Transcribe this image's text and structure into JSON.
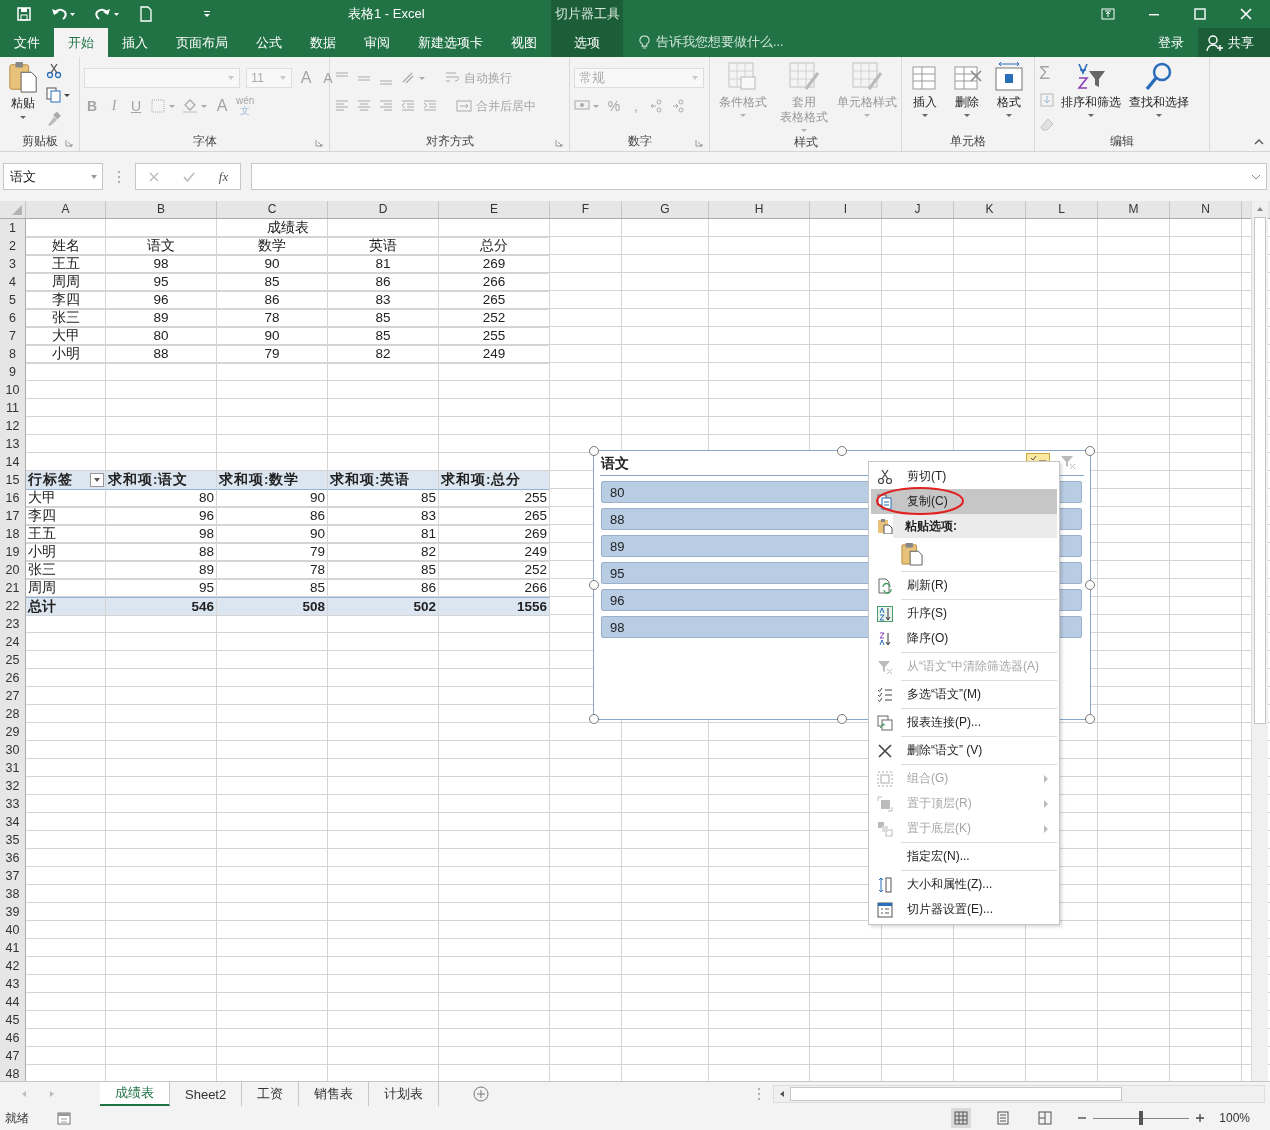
{
  "title_bar": {
    "title": "表格1 - Excel",
    "context_label": "切片器工具"
  },
  "tabs": [
    {
      "label": "文件",
      "selected": false,
      "kind": "file"
    },
    {
      "label": "开始",
      "selected": true,
      "kind": "normal"
    },
    {
      "label": "插入",
      "selected": false,
      "kind": "normal"
    },
    {
      "label": "页面布局",
      "selected": false,
      "kind": "normal"
    },
    {
      "label": "公式",
      "selected": false,
      "kind": "normal"
    },
    {
      "label": "数据",
      "selected": false,
      "kind": "normal"
    },
    {
      "label": "审阅",
      "selected": false,
      "kind": "normal"
    },
    {
      "label": "新建选项卡",
      "selected": false,
      "kind": "normal"
    },
    {
      "label": "视图",
      "selected": false,
      "kind": "normal"
    },
    {
      "label": "选项",
      "selected": false,
      "kind": "contextual"
    }
  ],
  "tell_me": {
    "placeholder": "告诉我您想要做什么..."
  },
  "account": {
    "sign_in": "登录",
    "share": "共享"
  },
  "ribbon": {
    "clipboard": {
      "label": "剪贴板",
      "paste": {
        "label": "粘贴",
        "disabled": false
      },
      "tools": [
        {
          "disabled": false
        },
        {
          "disabled": false
        },
        {
          "disabled": true
        }
      ]
    },
    "font": {
      "label": "字体",
      "disabled": true,
      "size": "11",
      "grow": "A",
      "shrink": "A",
      "bold": "B",
      "italic": "I",
      "underline": "U",
      "font_color": "A",
      "phonetic": [
        "wén",
        "文"
      ]
    },
    "alignment": {
      "label": "对齐方式",
      "disabled": true,
      "wrap_text": "自动换行",
      "merge_center": "合并后居中"
    },
    "number": {
      "label": "数字",
      "disabled": true,
      "format": "常规",
      "percent": "%",
      "comma": ","
    },
    "styles": {
      "label": "样式",
      "disabled": true,
      "commands": [
        {
          "lines": [
            "条件格式"
          ]
        },
        {
          "lines": [
            "套用",
            "表格格式"
          ]
        },
        {
          "lines": [
            "单元格样式"
          ]
        }
      ]
    },
    "cells": {
      "label": "单元格",
      "disabled": false,
      "commands": [
        {
          "lines": [
            "插入"
          ]
        },
        {
          "lines": [
            "删除"
          ]
        },
        {
          "lines": [
            "格式"
          ]
        }
      ]
    },
    "editing": {
      "label": "编辑",
      "sum": "Σ",
      "tools": [
        {
          "disabled": true
        },
        {
          "disabled": true
        },
        {
          "disabled": true
        }
      ],
      "commands": [
        {
          "lines": [
            "排序和筛选"
          ],
          "disabled": false
        },
        {
          "lines": [
            "查找和选择"
          ],
          "disabled": false
        }
      ]
    }
  },
  "formula_bar": {
    "name_box": "语文",
    "function_label": "fx"
  },
  "sheet": {
    "columns": [
      "A",
      "B",
      "C",
      "D",
      "E",
      "F",
      "G",
      "H",
      "I",
      "J",
      "K",
      "L",
      "M",
      "N"
    ],
    "row_numbers": [
      "1",
      "2",
      "3",
      "4",
      "5",
      "6",
      "7",
      "8",
      "9",
      "10",
      "11",
      "12",
      "13",
      "14",
      "15",
      "16",
      "17",
      "18",
      "19",
      "20",
      "21",
      "22",
      "23",
      "24",
      "25",
      "26",
      "27",
      "28",
      "29",
      "30",
      "31",
      "32",
      "33",
      "34",
      "35",
      "36",
      "37",
      "38",
      "39",
      "40",
      "41",
      "42",
      "43",
      "44",
      "45",
      "46",
      "47",
      "48"
    ],
    "table": {
      "title": "成绩表",
      "header": [
        "姓名",
        "语文",
        "数学",
        "英语",
        "总分"
      ],
      "rows": [
        [
          "王五",
          "98",
          "90",
          "81",
          "269"
        ],
        [
          "周周",
          "95",
          "85",
          "86",
          "266"
        ],
        [
          "李四",
          "96",
          "86",
          "83",
          "265"
        ],
        [
          "张三",
          "89",
          "78",
          "85",
          "252"
        ],
        [
          "大甲",
          "80",
          "90",
          "85",
          "255"
        ],
        [
          "小明",
          "88",
          "79",
          "82",
          "249"
        ]
      ]
    },
    "pivot": {
      "header": [
        "行标签",
        "求和项:语文",
        "求和项:数学",
        "求和项:英语",
        "求和项:总分"
      ],
      "filter_button": true,
      "rows": [
        [
          "大甲",
          "80",
          "90",
          "85",
          "255"
        ],
        [
          "李四",
          "96",
          "86",
          "83",
          "265"
        ],
        [
          "王五",
          "98",
          "90",
          "81",
          "269"
        ],
        [
          "小明",
          "88",
          "79",
          "82",
          "249"
        ],
        [
          "张三",
          "89",
          "78",
          "85",
          "252"
        ],
        [
          "周周",
          "95",
          "85",
          "86",
          "266"
        ]
      ],
      "total": [
        "总计",
        "546",
        "508",
        "502",
        "1556"
      ]
    }
  },
  "slicer": {
    "title": "语文",
    "multi_select": true,
    "items": [
      {
        "label": "80",
        "selected": true
      },
      {
        "label": "88",
        "selected": true
      },
      {
        "label": "89",
        "selected": true
      },
      {
        "label": "95",
        "selected": true
      },
      {
        "label": "96",
        "selected": true
      },
      {
        "label": "98",
        "selected": true
      }
    ]
  },
  "context_menu": {
    "groups": [
      [
        {
          "kind": "item",
          "label": "剪切(T)",
          "disabled": false,
          "selected": false,
          "submenu": false
        },
        {
          "kind": "item",
          "label": "复制(C)",
          "disabled": false,
          "selected": true,
          "submenu": false
        },
        {
          "kind": "header",
          "label": "粘贴选项:"
        },
        {
          "kind": "paste_option"
        }
      ],
      [
        {
          "kind": "item",
          "label": "刷新(R)",
          "disabled": false,
          "selected": false,
          "submenu": false
        }
      ],
      [
        {
          "kind": "item",
          "label": "升序(S)",
          "disabled": false,
          "selected": false,
          "submenu": false
        },
        {
          "kind": "item",
          "label": "降序(O)",
          "disabled": false,
          "selected": false,
          "submenu": false
        }
      ],
      [
        {
          "kind": "item",
          "label": "从“语文”中清除筛选器(A)",
          "disabled": true,
          "selected": false,
          "submenu": false
        }
      ],
      [
        {
          "kind": "item",
          "label": "多选“语文”(M)",
          "disabled": false,
          "selected": false,
          "submenu": false
        }
      ],
      [
        {
          "kind": "item",
          "label": "报表连接(P)...",
          "disabled": false,
          "selected": false,
          "submenu": false
        }
      ],
      [
        {
          "kind": "item",
          "label": "删除“语文” (V)",
          "disabled": false,
          "selected": false,
          "submenu": false
        }
      ],
      [
        {
          "kind": "item",
          "label": "组合(G)",
          "disabled": true,
          "selected": false,
          "submenu": true
        },
        {
          "kind": "item",
          "label": "置于顶层(R)",
          "disabled": true,
          "selected": false,
          "submenu": true
        },
        {
          "kind": "item",
          "label": "置于底层(K)",
          "disabled": true,
          "selected": false,
          "submenu": true
        }
      ],
      [
        {
          "kind": "item",
          "label": "指定宏(N)...",
          "disabled": false,
          "selected": false,
          "submenu": false
        }
      ],
      [
        {
          "kind": "item",
          "label": "大小和属性(Z)...",
          "disabled": false,
          "selected": false,
          "submenu": false
        },
        {
          "kind": "item",
          "label": "切片器设置(E)...",
          "disabled": false,
          "selected": false,
          "submenu": false
        }
      ]
    ]
  },
  "sheet_tabs": [
    {
      "label": "成绩表",
      "selected": true
    },
    {
      "label": "Sheet2",
      "selected": false
    },
    {
      "label": "工资",
      "selected": false
    },
    {
      "label": "销售表",
      "selected": false
    },
    {
      "label": "计划表",
      "selected": false
    }
  ],
  "status_bar": {
    "status": "就绪",
    "zoom": "100%",
    "level": 0.5
  }
}
